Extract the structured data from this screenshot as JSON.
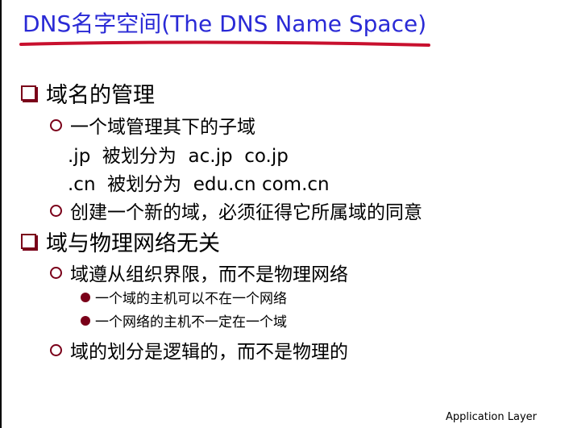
{
  "slide": {
    "title": "DNS名字空间(The DNS Name Space)",
    "items": [
      {
        "level": 1,
        "text": "域名的管理"
      },
      {
        "level": 2,
        "text": "一个域管理其下的子域"
      },
      {
        "level": 0,
        "text": ".jp  被划分为  ac.jp  co.jp"
      },
      {
        "level": 0,
        "text": ".cn  被划分为  edu.cn com.cn"
      },
      {
        "level": 2,
        "text": "创建一个新的域，必须征得它所属域的同意"
      },
      {
        "level": 1,
        "text": "域与物理网络无关"
      },
      {
        "level": 2,
        "text": "域遵从组织界限，而不是物理网络"
      },
      {
        "level": 3,
        "text": "一个域的主机可以不在一个网络"
      },
      {
        "level": 3,
        "text": "一个网络的主机不一定在一个域"
      },
      {
        "level": 2,
        "text": "域的划分是逻辑的，而不是物理的"
      }
    ],
    "footer": "Application Layer"
  },
  "colors": {
    "title": "#2a2ad6",
    "underline": "#c8102e",
    "bullet": "#7a0019"
  },
  "icons": {
    "level1": "square-box-icon",
    "level2": "hollow-circle-icon",
    "level3": "filled-disc-icon"
  }
}
